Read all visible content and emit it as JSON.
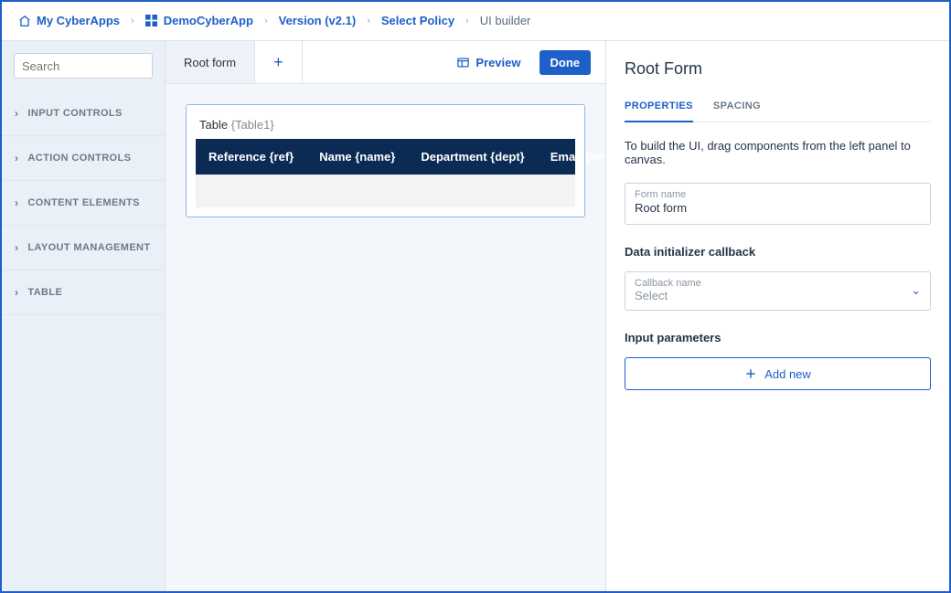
{
  "breadcrumbs": {
    "myapps": "My CyberApps",
    "app": "DemoCyberApp",
    "version": "Version (v2.1)",
    "policy": "Select Policy",
    "current": "UI builder"
  },
  "search": {
    "placeholder": "Search"
  },
  "sidebar": {
    "items": [
      {
        "label": "INPUT CONTROLS"
      },
      {
        "label": "ACTION CONTROLS"
      },
      {
        "label": "CONTENT ELEMENTS"
      },
      {
        "label": "LAYOUT MANAGEMENT"
      },
      {
        "label": "TABLE"
      }
    ]
  },
  "tabs": {
    "rootform": "Root form"
  },
  "actions": {
    "preview": "Preview",
    "done": "Done"
  },
  "canvas": {
    "table": {
      "title": "Table",
      "token": "{Table1}",
      "columns": [
        "Reference {ref}",
        "Name {name}",
        "Department {dept}",
        "Email {email}"
      ]
    }
  },
  "rightpanel": {
    "title": "Root Form",
    "tabs": {
      "properties": "PROPERTIES",
      "spacing": "SPACING"
    },
    "hint": "To build the UI, drag components from the left panel to canvas.",
    "formNameLabel": "Form name",
    "formNameValue": "Root form",
    "dataInitLabel": "Data initializer callback",
    "callbackLabel": "Callback name",
    "callbackValue": "Select",
    "inputParamsLabel": "Input parameters",
    "addNew": "Add new"
  }
}
